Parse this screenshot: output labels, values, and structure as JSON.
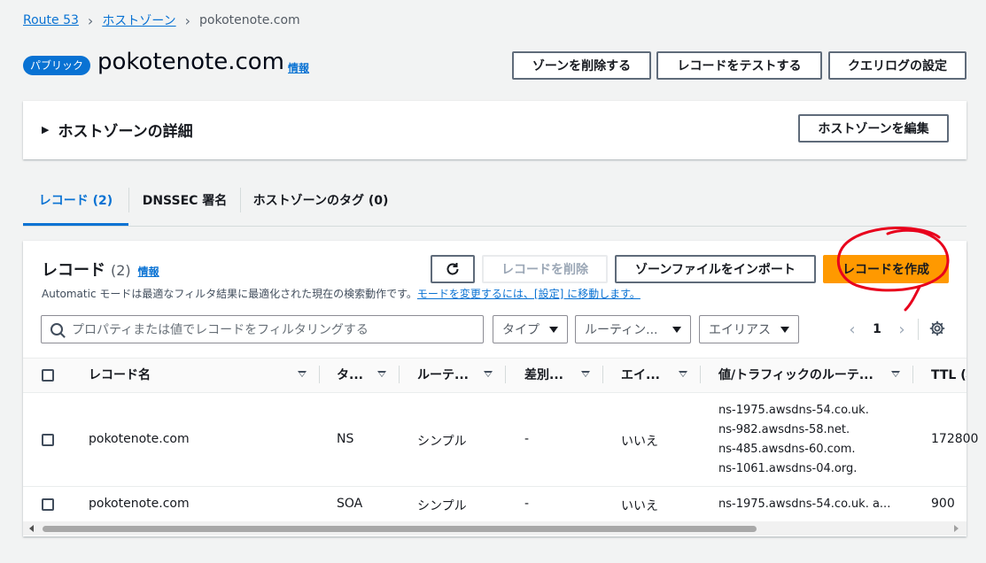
{
  "breadcrumb": {
    "root": "Route 53",
    "parent": "ホストゾーン",
    "current": "pokotenote.com"
  },
  "header": {
    "badge": "パブリック",
    "title": "pokotenote.com",
    "info": "情報",
    "buttons": {
      "delete_zone": "ゾーンを削除する",
      "test_record": "レコードをテストする",
      "query_log": "クエリログの設定"
    }
  },
  "details_panel": {
    "title": "ホストゾーンの詳細",
    "edit_button": "ホストゾーンを編集"
  },
  "tabs": [
    {
      "label": "レコード (2)",
      "active": true
    },
    {
      "label": "DNSSEC 署名",
      "active": false
    },
    {
      "label": "ホストゾーンのタグ (0)",
      "active": false
    }
  ],
  "records": {
    "title": "レコード",
    "count": "(2)",
    "info": "情報",
    "description": "Automatic モードは最適なフィルタ結果に最適化された現在の検索動作です。",
    "description_link": "モードを変更するには、[設定] に移動します。",
    "buttons": {
      "delete": "レコードを削除",
      "import": "ゾーンファイルをインポート",
      "create": "レコードを作成"
    },
    "filter_placeholder": "プロパティまたは値でレコードをフィルタリングする",
    "dropdowns": [
      "タイプ",
      "ルーティン...",
      "エイリアス"
    ],
    "page": "1",
    "columns": [
      "レコード名",
      "タ...",
      "ルーテ...",
      "差別...",
      "エイ...",
      "値/トラフィックのルーテ...",
      "TTL (秒"
    ],
    "rows": [
      {
        "name": "pokotenote.com",
        "type": "NS",
        "routing": "シンプル",
        "diff": "-",
        "alias": "いいえ",
        "values": [
          "ns-1975.awsdns-54.co.uk.",
          "ns-982.awsdns-58.net.",
          "ns-485.awsdns-60.com.",
          "ns-1061.awsdns-04.org."
        ],
        "ttl": "172800"
      },
      {
        "name": "pokotenote.com",
        "type": "SOA",
        "routing": "シンプル",
        "diff": "-",
        "alias": "いいえ",
        "values": [
          "ns-1975.awsdns-54.co.uk. a..."
        ],
        "ttl": "900"
      }
    ]
  },
  "colors": {
    "link": "#0972d3",
    "primary": "#ff9900",
    "annotation": "#e8001c"
  }
}
